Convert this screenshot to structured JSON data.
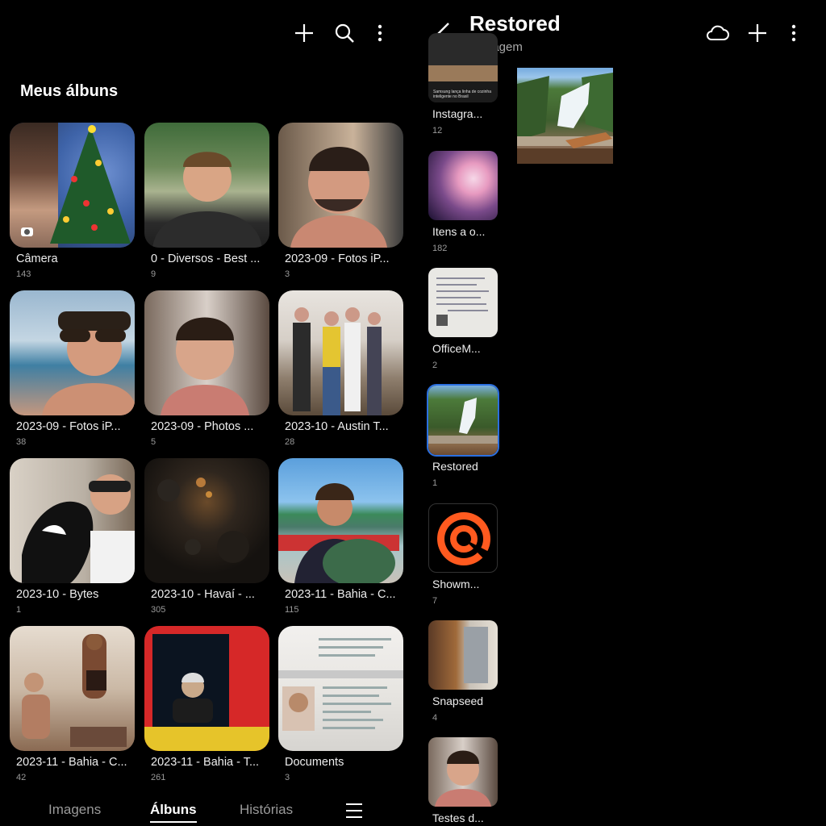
{
  "left": {
    "section_title": "Meus álbuns",
    "albums": [
      {
        "name": "Câmera",
        "count": "143"
      },
      {
        "name": "0 - Diversos - Best ...",
        "count": "9"
      },
      {
        "name": "2023-09 - Fotos iP...",
        "count": "3"
      },
      {
        "name": "2023-09 - Fotos iP...",
        "count": "38"
      },
      {
        "name": "2023-09 - Photos ...",
        "count": "5"
      },
      {
        "name": "2023-10 - Austin T...",
        "count": "28"
      },
      {
        "name": "2023-10 - Bytes",
        "count": "1"
      },
      {
        "name": "2023-10 - Havaí - ...",
        "count": "305"
      },
      {
        "name": "2023-11 - Bahia - C...",
        "count": "115"
      },
      {
        "name": "2023-11 - Bahia - C...",
        "count": "42"
      },
      {
        "name": "2023-11 - Bahia - T...",
        "count": "261"
      },
      {
        "name": "Documents",
        "count": "3"
      }
    ],
    "bottom_nav": {
      "images": "Imagens",
      "albums": "Álbuns",
      "stories": "Histórias"
    }
  },
  "right": {
    "title": "Restored",
    "subtitle": "1 imagem",
    "strip": [
      {
        "name": "Instagra...",
        "count": "12"
      },
      {
        "name": "Itens a o...",
        "count": "182"
      },
      {
        "name": "OfficeM...",
        "count": "2"
      },
      {
        "name": "Restored",
        "count": "1"
      },
      {
        "name": "Showm...",
        "count": "7"
      },
      {
        "name": "Snapseed",
        "count": "4"
      },
      {
        "name": "Testes d...",
        "count": ""
      }
    ],
    "instagram_thumb_text": "Samsung lança linha de cozinha inteligente no Brasil"
  },
  "icons": {
    "left_toolbar": [
      "plus-icon",
      "search-icon",
      "more-vert-icon"
    ],
    "right_toolbar": [
      "back-arrow-icon",
      "cloud-icon",
      "plus-icon",
      "more-vert-icon"
    ],
    "menu": "hamburger-menu-icon"
  },
  "colors": {
    "background": "#000000",
    "accent_selected": "#2b6fe0",
    "muted_text": "#999999"
  }
}
